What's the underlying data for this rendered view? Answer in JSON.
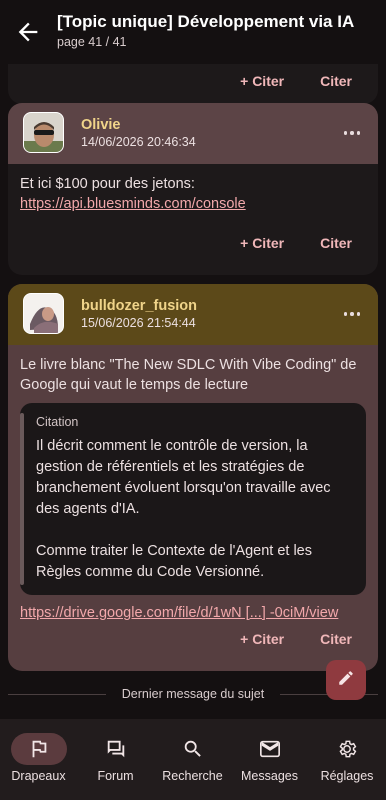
{
  "header": {
    "title": "[Topic unique] Développement via IA",
    "subtitle": "page 41 / 41"
  },
  "posts": [
    {
      "actions": {
        "quote_plus": "+ Citer",
        "quote": "Citer"
      }
    },
    {
      "author": "Olivie",
      "date": "14/06/2026 20:46:34",
      "text": "Et ici $100 pour des jetons:",
      "link": "https://api.bluesminds.com/console",
      "actions": {
        "quote_plus": "+ Citer",
        "quote": "Citer"
      }
    },
    {
      "author": "bulldozer_fusion",
      "date": "15/06/2026 21:54:44",
      "text": "Le livre blanc \"The New SDLC With Vibe Coding\" de Google qui vaut le temps de lecture",
      "quote": {
        "label": "Citation",
        "paragraph1": "Il décrit comment le contrôle de version, la gestion de référentiels et les stratégies de branchement évoluent lorsqu'on travaille avec des agents d'IA.",
        "paragraph2": "Comme traiter le Contexte de l'Agent et les Règles comme du Code Versionné."
      },
      "link": "https://drive.google.com/file/d/1wN [...] -0ciM/view",
      "actions": {
        "quote_plus": "+ Citer",
        "quote": "Citer"
      }
    }
  ],
  "divider": "Dernier message du sujet",
  "fab": {
    "icon": "pencil-icon"
  },
  "nav": [
    {
      "label": "Drapeaux",
      "icon": "flag-icon",
      "active": true
    },
    {
      "label": "Forum",
      "icon": "forum-icon",
      "active": false
    },
    {
      "label": "Recherche",
      "icon": "search-icon",
      "active": false
    },
    {
      "label": "Messages",
      "icon": "mail-icon",
      "active": false
    },
    {
      "label": "Réglages",
      "icon": "gear-icon",
      "active": false
    }
  ],
  "colors": {
    "background": "#141011",
    "accent": "#f0b7b9",
    "author": "#f0d48a",
    "fab": "#8f3a3f"
  }
}
